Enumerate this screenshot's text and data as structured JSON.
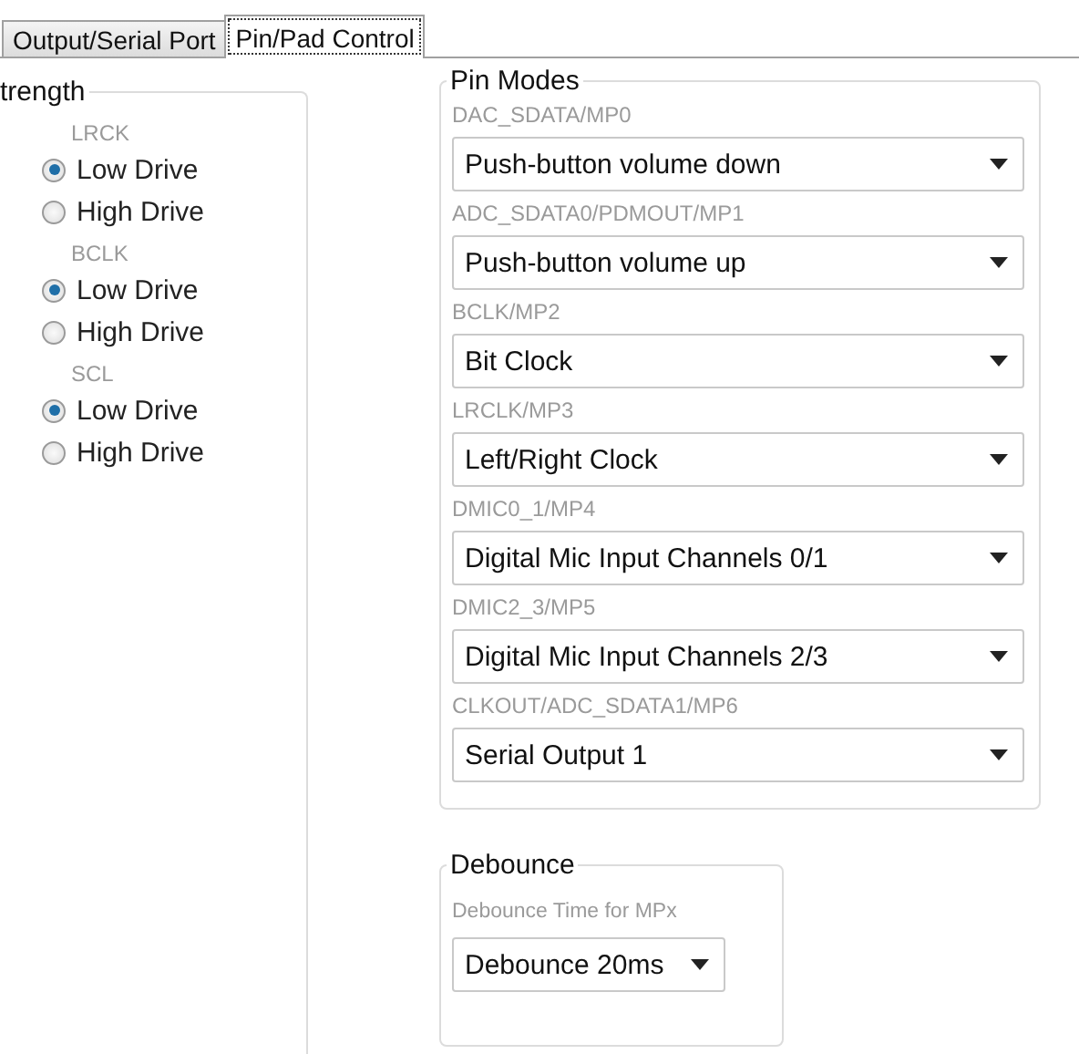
{
  "tabs": [
    {
      "label": "Output/Serial Port",
      "selected": false
    },
    {
      "label": "Pin/Pad Control",
      "selected": true
    }
  ],
  "drive_strength": {
    "title": "trength",
    "pins": [
      {
        "name": "LRCK",
        "options": [
          {
            "label": "Low Drive",
            "selected": true
          },
          {
            "label": "High Drive",
            "selected": false
          }
        ]
      },
      {
        "name": "BCLK",
        "options": [
          {
            "label": "Low Drive",
            "selected": true
          },
          {
            "label": "High Drive",
            "selected": false
          }
        ]
      },
      {
        "name": "SCL",
        "options": [
          {
            "label": "Low Drive",
            "selected": true
          },
          {
            "label": "High Drive",
            "selected": false
          }
        ]
      }
    ]
  },
  "pin_modes": {
    "title": "Pin Modes",
    "pins": [
      {
        "label": "DAC_SDATA/MP0",
        "value": "Push-button volume down"
      },
      {
        "label": "ADC_SDATA0/PDMOUT/MP1",
        "value": "Push-button volume up"
      },
      {
        "label": "BCLK/MP2",
        "value": "Bit Clock"
      },
      {
        "label": "LRCLK/MP3",
        "value": "Left/Right Clock"
      },
      {
        "label": "DMIC0_1/MP4",
        "value": "Digital Mic Input Channels 0/1"
      },
      {
        "label": "DMIC2_3/MP5",
        "value": "Digital Mic Input Channels 2/3"
      },
      {
        "label": "CLKOUT/ADC_SDATA1/MP6",
        "value": "Serial Output 1"
      }
    ]
  },
  "debounce": {
    "title": "Debounce",
    "label": "Debounce Time for MPx",
    "value": "Debounce 20ms"
  }
}
